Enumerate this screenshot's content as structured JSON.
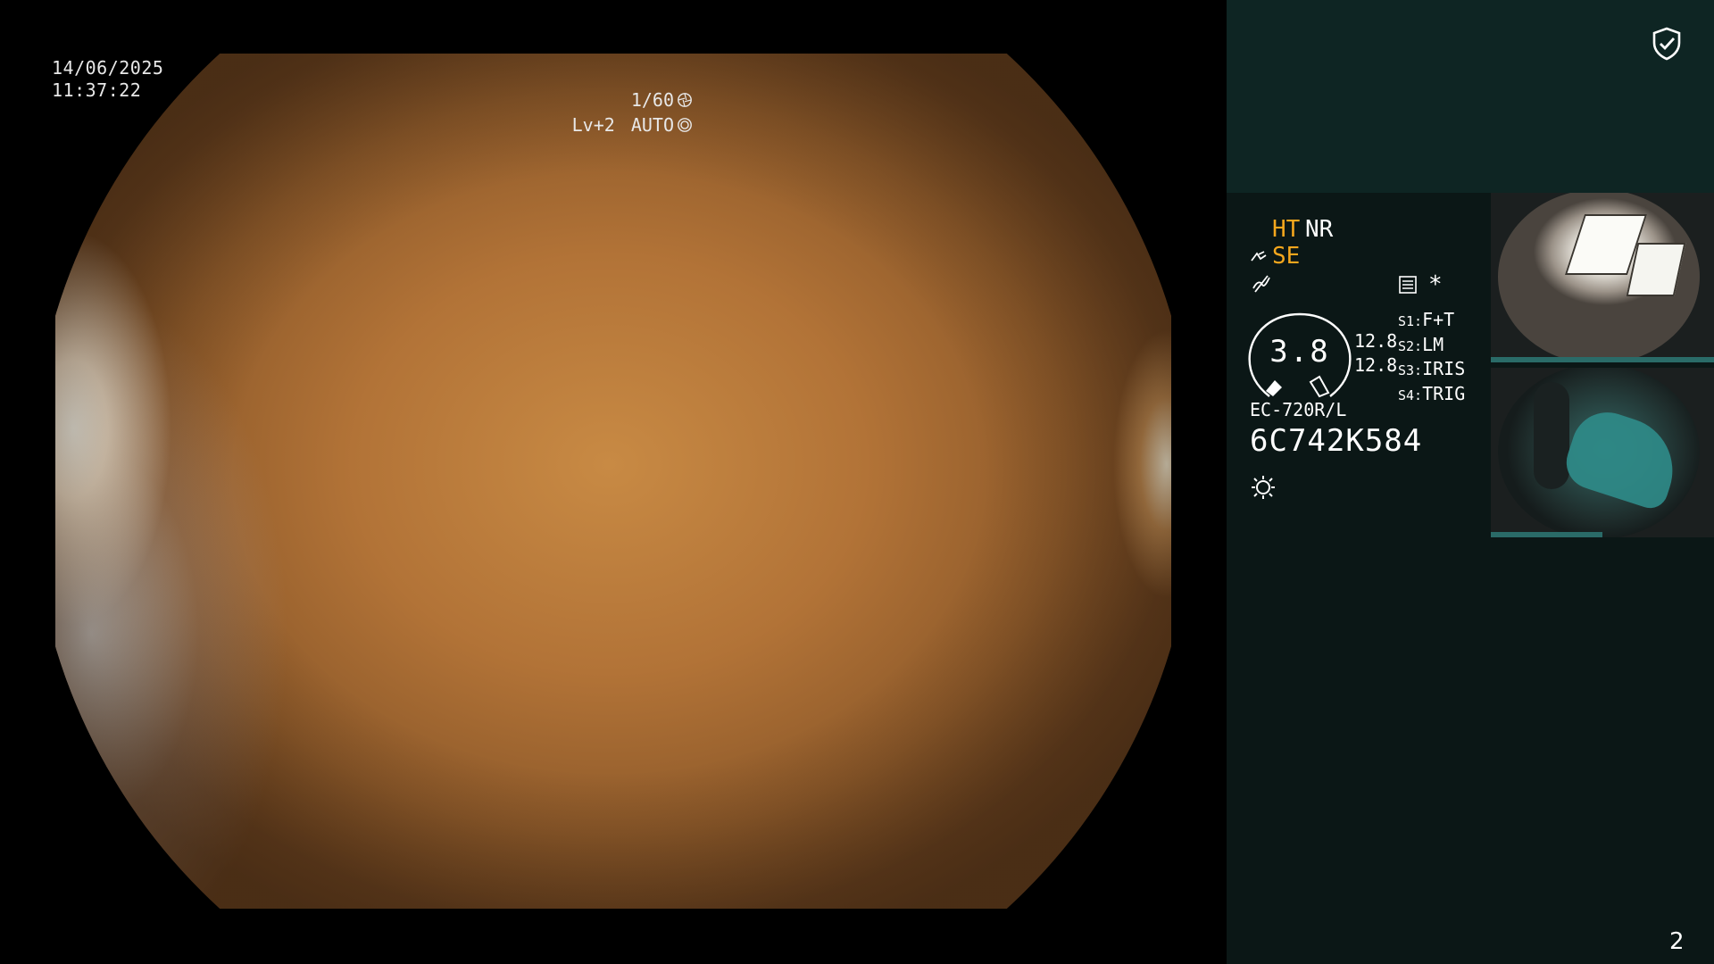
{
  "overlay": {
    "date": "14/06/2025",
    "time": "11:37:22",
    "shutter": "1/60",
    "exposure_level": "Lv+2",
    "exposure_mode": "AUTO"
  },
  "status": {
    "ht": "HT",
    "nr": "NR",
    "se": "SE",
    "asterisk": "*",
    "gauge_value": "3.8",
    "value_a": "12.8",
    "value_b": "12.8",
    "switches": [
      {
        "key": "S1:",
        "value": "F+T"
      },
      {
        "key": "S2:",
        "value": "LM"
      },
      {
        "key": "S3:",
        "value": "IRIS"
      },
      {
        "key": "S4:",
        "value": "TRIG"
      }
    ],
    "scope_model": "EC-720R/L",
    "serial": "6C742K584"
  },
  "page_number": "2",
  "colors": {
    "accent_orange": "#f5a71d",
    "panel_dark": "#0b1716",
    "panel_top": "#0e2523"
  },
  "icons": [
    "shield-check-icon",
    "shutter-icon",
    "auto-iris-icon",
    "se-mode-icon",
    "wave-icon",
    "sheet-icon",
    "gauge-icon",
    "light-source-icon"
  ]
}
